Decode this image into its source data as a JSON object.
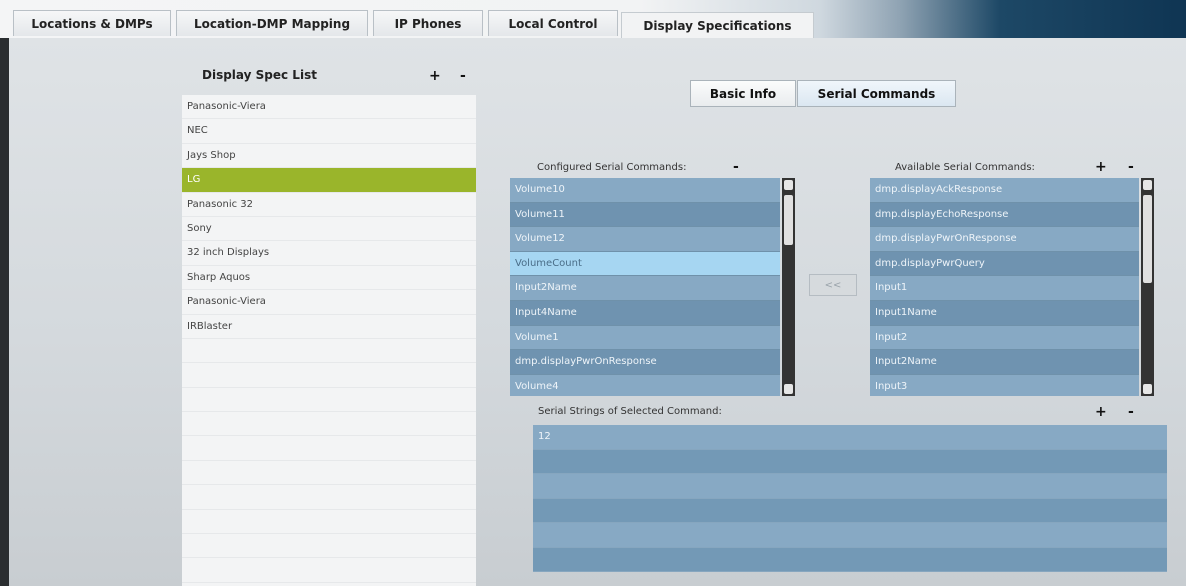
{
  "tabs": [
    {
      "label": "Locations & DMPs"
    },
    {
      "label": "Location-DMP Mapping"
    },
    {
      "label": "IP Phones"
    },
    {
      "label": "Local Control"
    },
    {
      "label": "Display Specifications"
    }
  ],
  "display_spec": {
    "title": "Display Spec List",
    "add": "+",
    "remove": "-",
    "items": [
      "Panasonic-Viera",
      "NEC",
      "Jays Shop",
      "LG",
      "Panasonic 32",
      "Sony",
      "32 inch Displays",
      "Sharp Aquos",
      "Panasonic-Viera",
      "IRBlaster"
    ],
    "selected_index": 3
  },
  "subtabs": {
    "basic_info": "Basic Info",
    "serial_commands": "Serial Commands"
  },
  "configured": {
    "label": "Configured Serial Commands:",
    "remove": "-",
    "items": [
      "Volume10",
      "Volume11",
      "Volume12",
      "VolumeCount",
      "Input2Name",
      "Input4Name",
      "Volume1",
      "dmp.displayPwrOnResponse",
      "Volume4"
    ],
    "selected_index": 3
  },
  "move_button": "<<",
  "available": {
    "label": "Available Serial Commands:",
    "add": "+",
    "remove": "-",
    "items": [
      "dmp.displayAckResponse",
      "dmp.displayEchoResponse",
      "dmp.displayPwrOnResponse",
      "dmp.displayPwrQuery",
      "Input1",
      "Input1Name",
      "Input2",
      "Input2Name",
      "Input3"
    ]
  },
  "serial_strings": {
    "label": "Serial Strings of Selected Command:",
    "add": "+",
    "remove": "-",
    "rows": [
      "12",
      "",
      "",
      "",
      "",
      ""
    ]
  },
  "colors": {
    "selected_spec": "#9ab52b",
    "list_light": "#87a9c4",
    "list_dark": "#6f93b0",
    "list_selected": "#a6d6f2"
  }
}
